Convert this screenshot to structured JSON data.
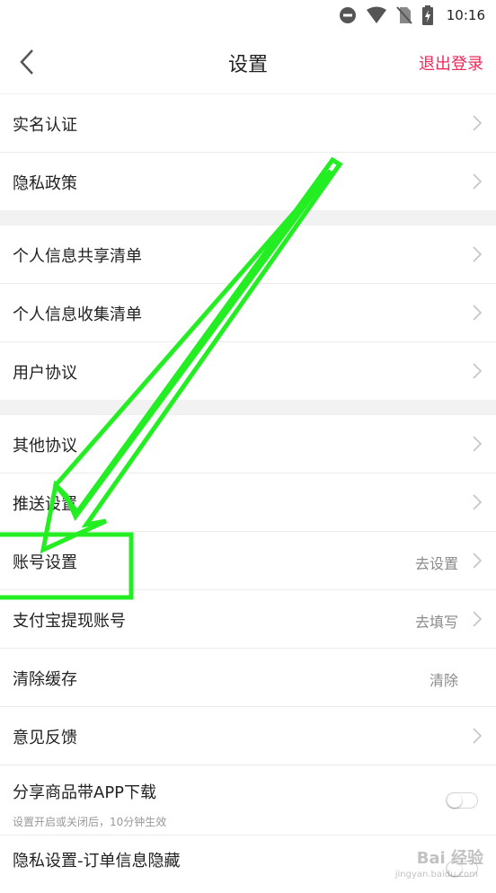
{
  "status": {
    "time": "10:16"
  },
  "header": {
    "title": "设置",
    "logout_label": "退出登录",
    "accent": "#ee2a5a"
  },
  "groups": [
    {
      "items": [
        {
          "label": "实名认证"
        },
        {
          "label": "隐私政策"
        }
      ]
    },
    {
      "items": [
        {
          "label": "个人信息共享清单"
        },
        {
          "label": "个人信息收集清单"
        },
        {
          "label": "用户协议"
        }
      ]
    },
    {
      "items": [
        {
          "label": "其他协议"
        },
        {
          "label": "推送设置"
        },
        {
          "label": "账号设置",
          "value": "去设置"
        },
        {
          "label": "支付宝提现账号",
          "value": "去填写"
        },
        {
          "label": "清除缓存",
          "value": "清除"
        },
        {
          "label": "意见反馈"
        },
        {
          "label": "分享商品带APP下载",
          "subtitle": "设置开启或关闭后，10分钟生效",
          "toggle": false
        },
        {
          "label": "隐私设置-订单信息隐藏",
          "toggle": false
        }
      ]
    }
  ],
  "watermark": {
    "brand": "Bai 经验",
    "sub": "jingyan.baidu.com"
  }
}
